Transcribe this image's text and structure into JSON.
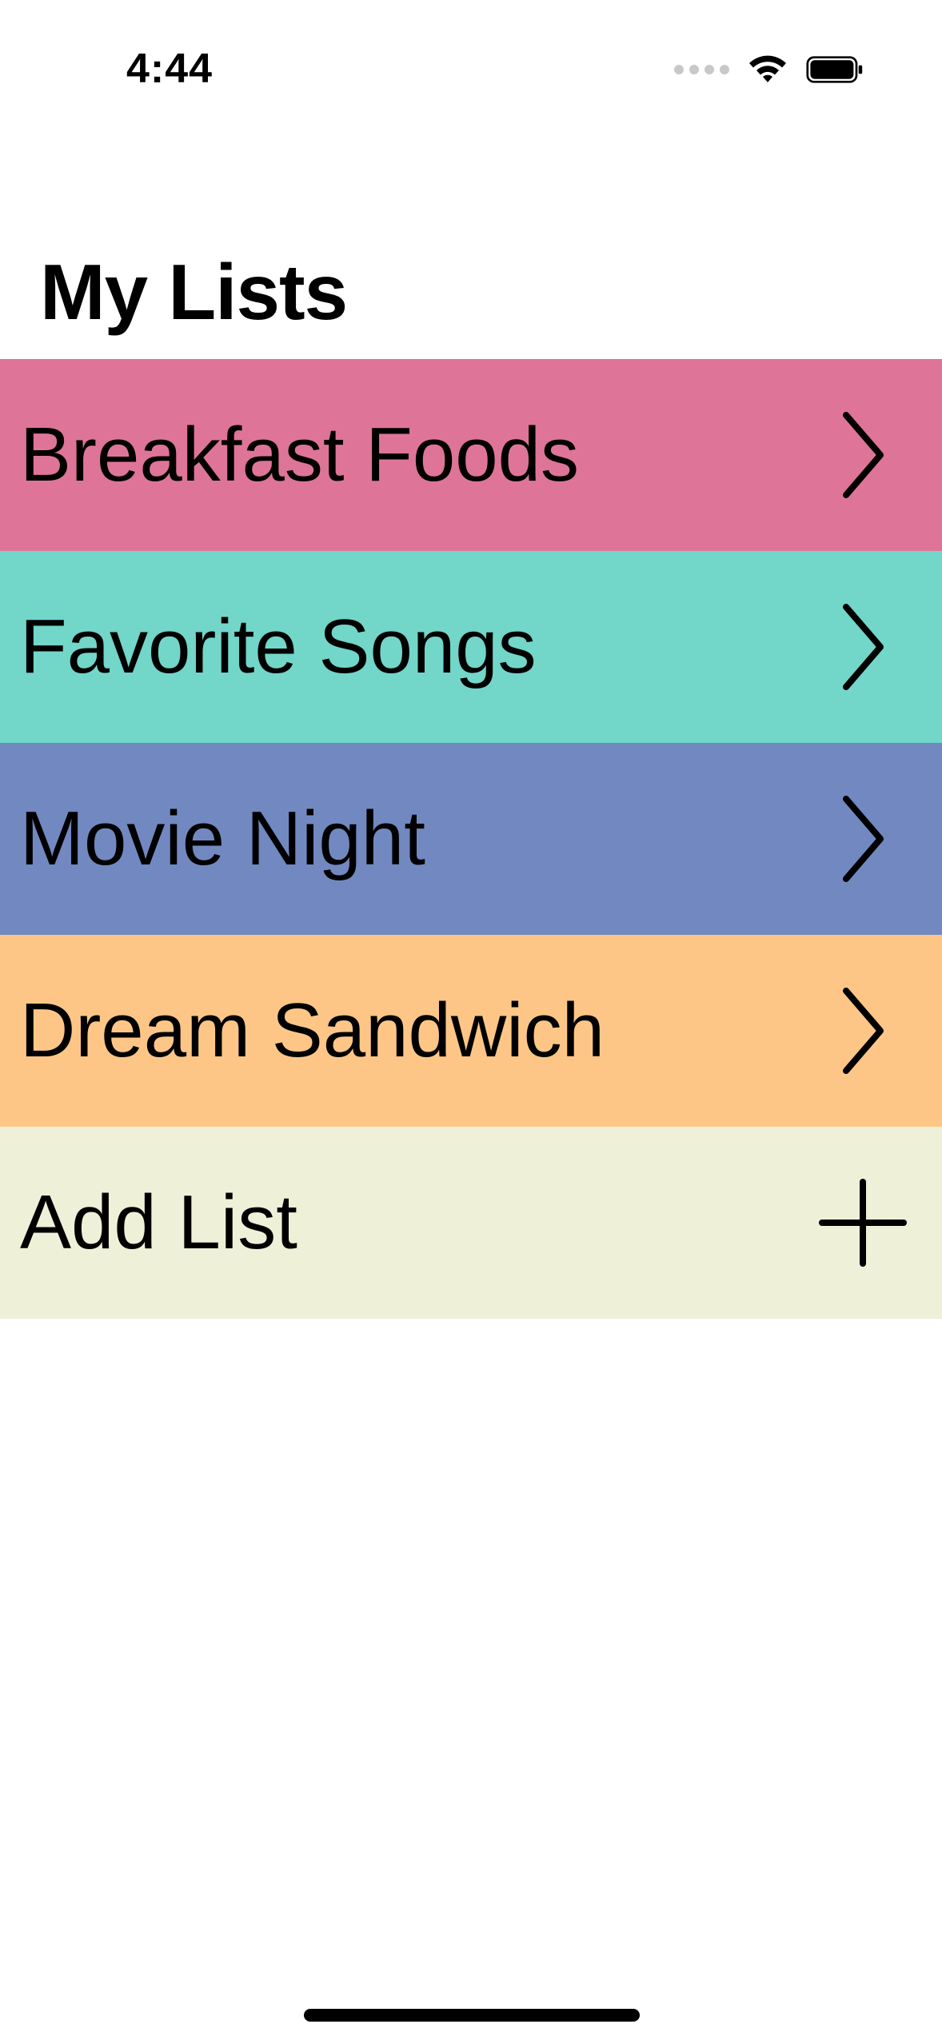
{
  "status_bar": {
    "time": "4:44"
  },
  "header": {
    "title": "My Lists"
  },
  "lists": [
    {
      "label": "Breakfast Foods",
      "color": "#DE7598",
      "icon": "chevron-right-icon"
    },
    {
      "label": "Favorite Songs",
      "color": "#72D6C9",
      "icon": "chevron-right-icon"
    },
    {
      "label": "Movie Night",
      "color": "#7288C0",
      "icon": "chevron-right-icon"
    },
    {
      "label": "Dream Sandwich",
      "color": "#FDC687",
      "icon": "chevron-right-icon"
    }
  ],
  "add_list": {
    "label": "Add List",
    "color": "#EFF0D8",
    "icon": "plus-icon"
  }
}
